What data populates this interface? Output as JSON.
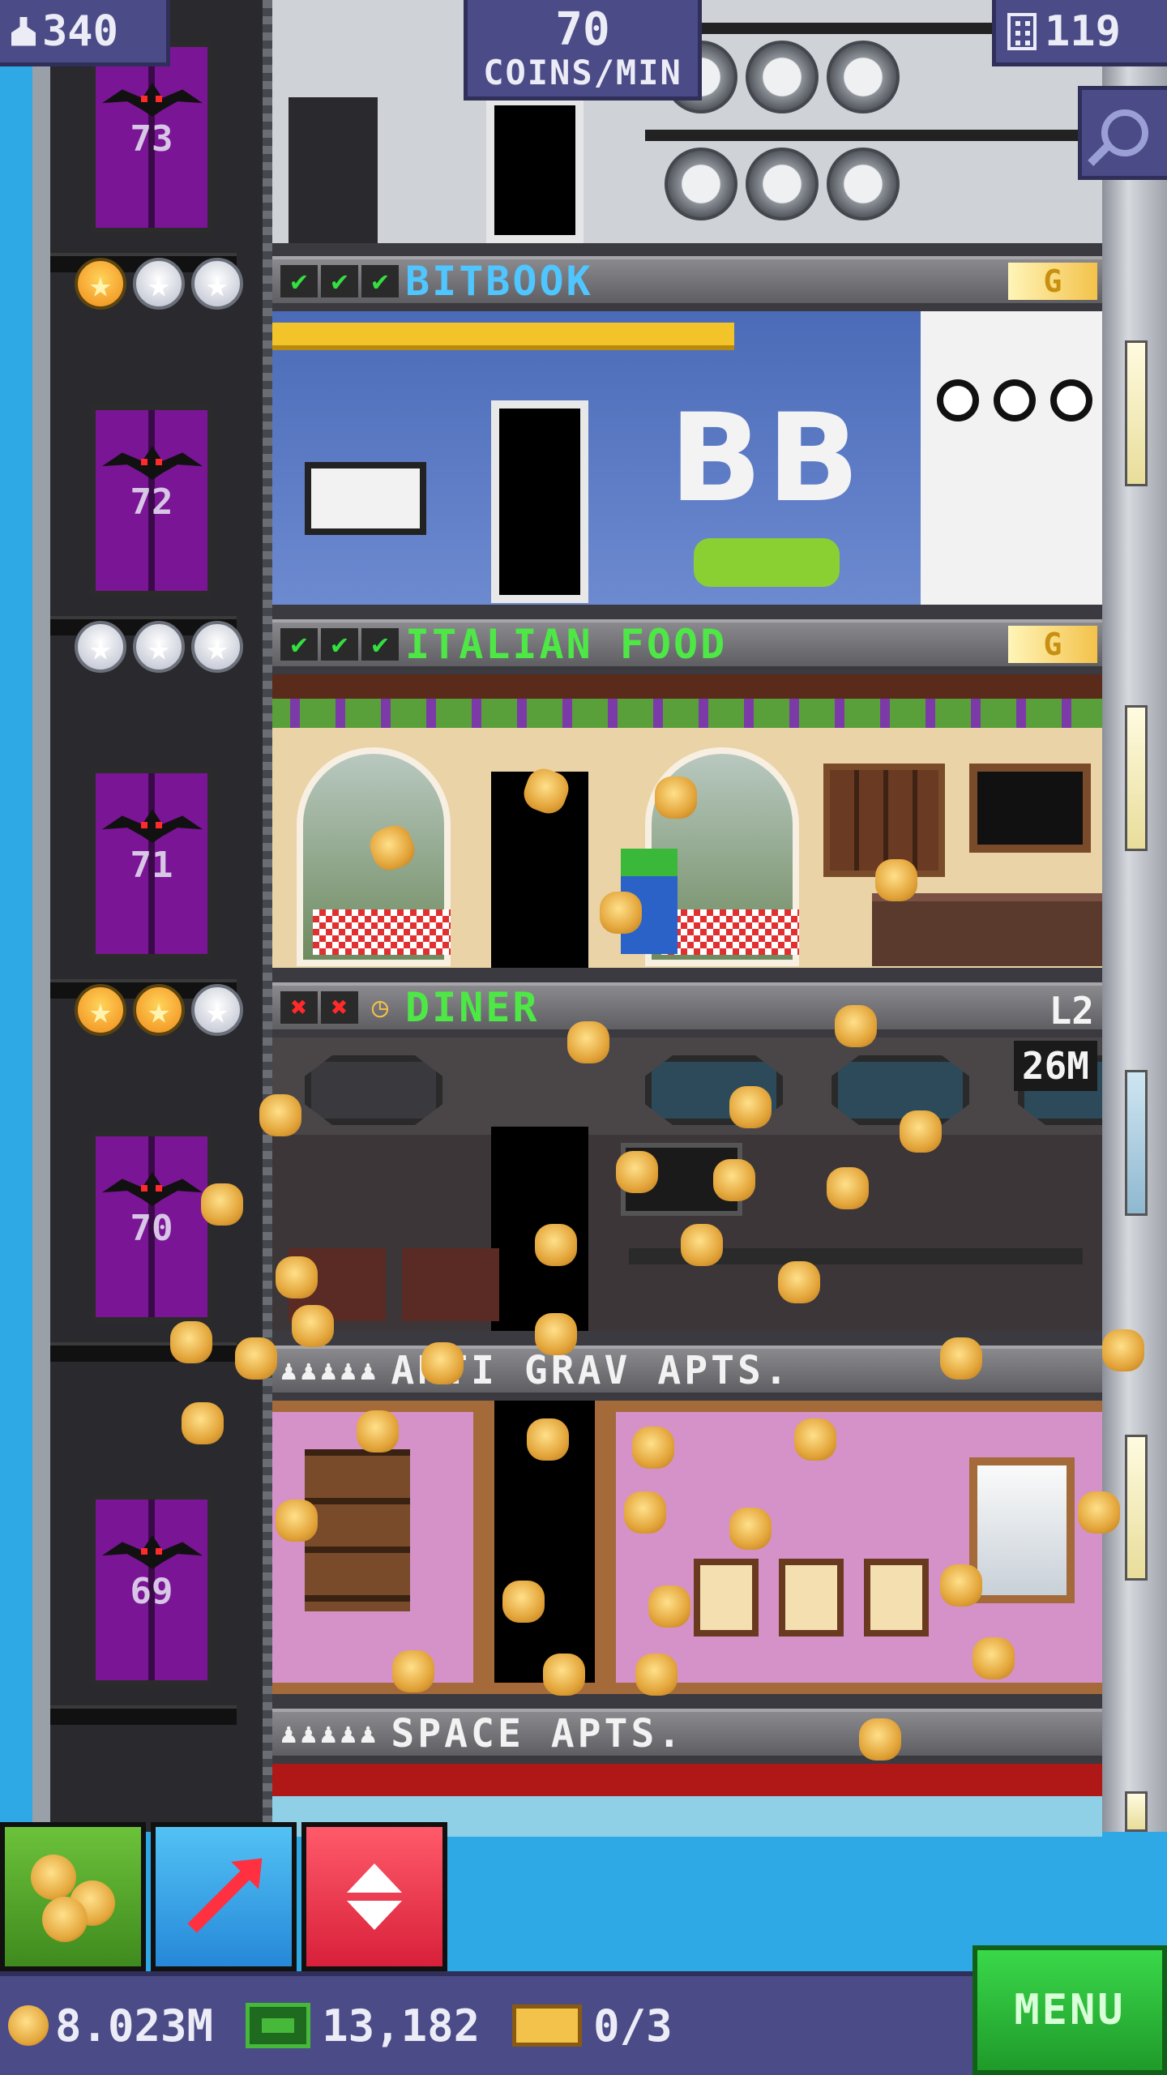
{
  "hud": {
    "population": "340",
    "coins_per_min_value": "70",
    "coins_per_min_label": "COINS/MIN",
    "floor_count": "119"
  },
  "elevator": {
    "floors": [
      {
        "number": "73"
      },
      {
        "number": "72",
        "stars": [
          "gold",
          "silver",
          "silver"
        ]
      },
      {
        "number": "71",
        "stars": [
          "silver",
          "silver",
          "silver"
        ]
      },
      {
        "number": "70",
        "stars": [
          "gold",
          "gold",
          "silver"
        ]
      },
      {
        "number": "69"
      }
    ]
  },
  "floors": {
    "bitbook": {
      "name": "BITBOOK",
      "name_color": "#4fc6ff",
      "checks": [
        "ok",
        "ok",
        "ok"
      ],
      "badge": "G",
      "sign": "BB"
    },
    "italian": {
      "name": "ITALIAN FOOD",
      "name_color": "#4ee846",
      "checks": [
        "ok",
        "ok",
        "ok"
      ],
      "badge": "G"
    },
    "diner": {
      "name": "DINER",
      "name_color": "#4ee846",
      "checks": [
        "bad",
        "bad",
        "clock"
      ],
      "level": "L2",
      "timer": "26M"
    },
    "anti_grav": {
      "name": "ANTI GRAV APTS.",
      "residents": "♟♟♟♟♟"
    },
    "space": {
      "name": "SPACE APTS.",
      "residents": "♟♟♟♟♟"
    }
  },
  "bottom_bar": {
    "coins": "8.023M",
    "bux": "13,182",
    "tickets": "0/3",
    "menu_label": "MENU"
  },
  "icons": {
    "population": "person-icon",
    "floors": "building-icon",
    "zoom": "magnifier-icon",
    "coins_button": "coin-stack-icon",
    "dig_button": "arrow-icon",
    "elevator_button": "up-down-icon"
  },
  "colors": {
    "hud_bg": "#4b4b87",
    "sky": "#2fa9e6",
    "menu_green": "#2fbf3a",
    "elevator_purple": "#7a1596"
  }
}
